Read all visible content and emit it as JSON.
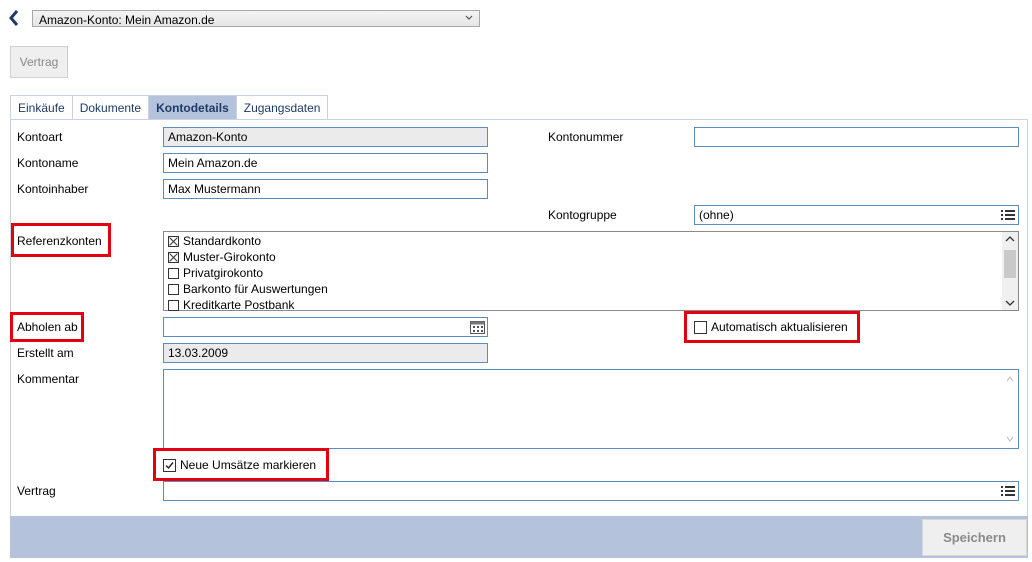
{
  "header": {
    "account_select": "Amazon-Konto: Mein Amazon.de",
    "vertrag_button": "Vertrag"
  },
  "tabs": [
    {
      "label": "Einkäufe"
    },
    {
      "label": "Dokumente"
    },
    {
      "label": "Kontodetails"
    },
    {
      "label": "Zugangsdaten"
    }
  ],
  "form": {
    "kontoart": {
      "label": "Kontoart",
      "value": "Amazon-Konto"
    },
    "kontoname": {
      "label": "Kontoname",
      "value": "Mein Amazon.de"
    },
    "kontoinhaber": {
      "label": "Kontoinhaber",
      "value": "Max Mustermann"
    },
    "kontonummer": {
      "label": "Kontonummer",
      "value": ""
    },
    "kontogruppe": {
      "label": "Kontogruppe",
      "value": "(ohne)"
    },
    "referenzkonten": {
      "label": "Referenzkonten",
      "items": [
        {
          "label": "Standardkonto",
          "checked": true
        },
        {
          "label": "Muster-Girokonto",
          "checked": true
        },
        {
          "label": "Privatgirokonto",
          "checked": false
        },
        {
          "label": "Barkonto für Auswertungen",
          "checked": false
        },
        {
          "label": "Kreditkarte Postbank",
          "checked": false
        }
      ]
    },
    "abholen_ab": {
      "label": "Abholen ab",
      "value": ""
    },
    "auto_update": {
      "label": "Automatisch aktualisieren",
      "checked": false
    },
    "erstellt_am": {
      "label": "Erstellt am",
      "value": "13.03.2009"
    },
    "kommentar": {
      "label": "Kommentar",
      "value": ""
    },
    "neue_umsaetze": {
      "label": "Neue Umsätze markieren",
      "checked": true
    },
    "vertrag": {
      "label": "Vertrag",
      "value": ""
    }
  },
  "footer": {
    "save_button": "Speichern"
  },
  "colors": {
    "highlight": "#e3000f",
    "tab_active": "#b4c3db",
    "footer_bar": "#b4c3db",
    "field_border": "#5b8bc0"
  }
}
